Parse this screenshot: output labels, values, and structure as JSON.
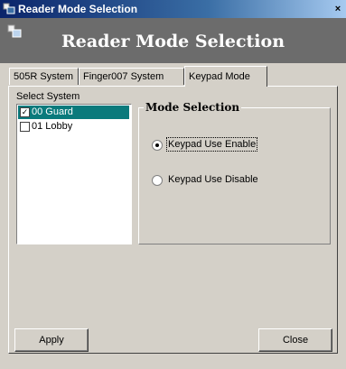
{
  "window": {
    "title": "Reader Mode Selection",
    "close_glyph": "×",
    "icon": "app-icon"
  },
  "banner": {
    "title": "Reader Mode Selection",
    "icon": "app-icon"
  },
  "tabs": [
    {
      "label": "505R System",
      "active": false
    },
    {
      "label": "Finger007 System",
      "active": false
    },
    {
      "label": "Keypad Mode",
      "active": true
    }
  ],
  "select_system": {
    "label": "Select System",
    "items": [
      {
        "label": "00 Guard",
        "checked": true,
        "selected": true
      },
      {
        "label": "01 Lobby",
        "checked": false,
        "selected": false
      }
    ]
  },
  "mode_selection": {
    "title": "Mode Selection",
    "options": [
      {
        "label": "Keypad Use Enable",
        "selected": true
      },
      {
        "label": "Keypad Use Disable",
        "selected": false
      }
    ]
  },
  "buttons": {
    "apply": "Apply",
    "close": "Close"
  },
  "colors": {
    "title_bar": "#0a246a",
    "banner": "#6c6c6c",
    "selection": "#0a7a7c",
    "face": "#d4d0c8"
  }
}
